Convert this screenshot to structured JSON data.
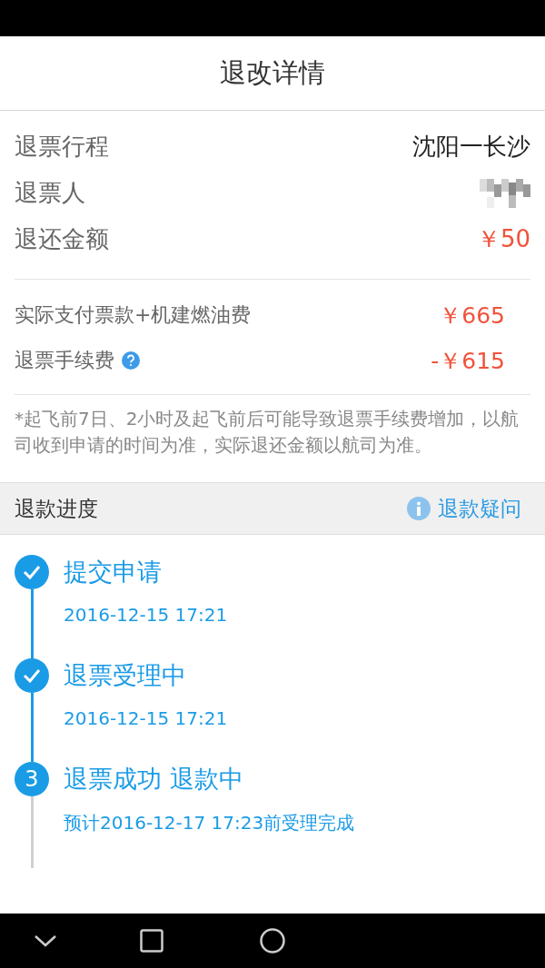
{
  "header": {
    "title": "退改详情"
  },
  "summary": [
    {
      "label": "退票行程",
      "kind": "text",
      "value": "沈阳一长沙"
    },
    {
      "label": "退票人",
      "kind": "blurred"
    },
    {
      "label": "退还金额",
      "kind": "amount",
      "value": "￥50"
    }
  ],
  "fees": [
    {
      "label": "实际支付票款+机建燃油费",
      "value": "￥665",
      "help": false
    },
    {
      "label": "退票手续费",
      "value": "-￥615",
      "help": true
    }
  ],
  "note": "*起飞前7日、2小时及起飞前后可能导致退票手续费增加，以航司收到申请的时间为准，实际退还金额以航司为准。",
  "progress": {
    "title": "退款进度",
    "link": "退款疑问",
    "steps": [
      {
        "done": true,
        "title": "提交申请",
        "detail": "2016-12-15 17:21"
      },
      {
        "done": true,
        "title": "退票受理中",
        "detail": "2016-12-15 17:21"
      },
      {
        "done": false,
        "number": "3",
        "title": "退票成功 退款中",
        "detail": "预计2016-12-17 17:23前受理完成"
      }
    ]
  }
}
